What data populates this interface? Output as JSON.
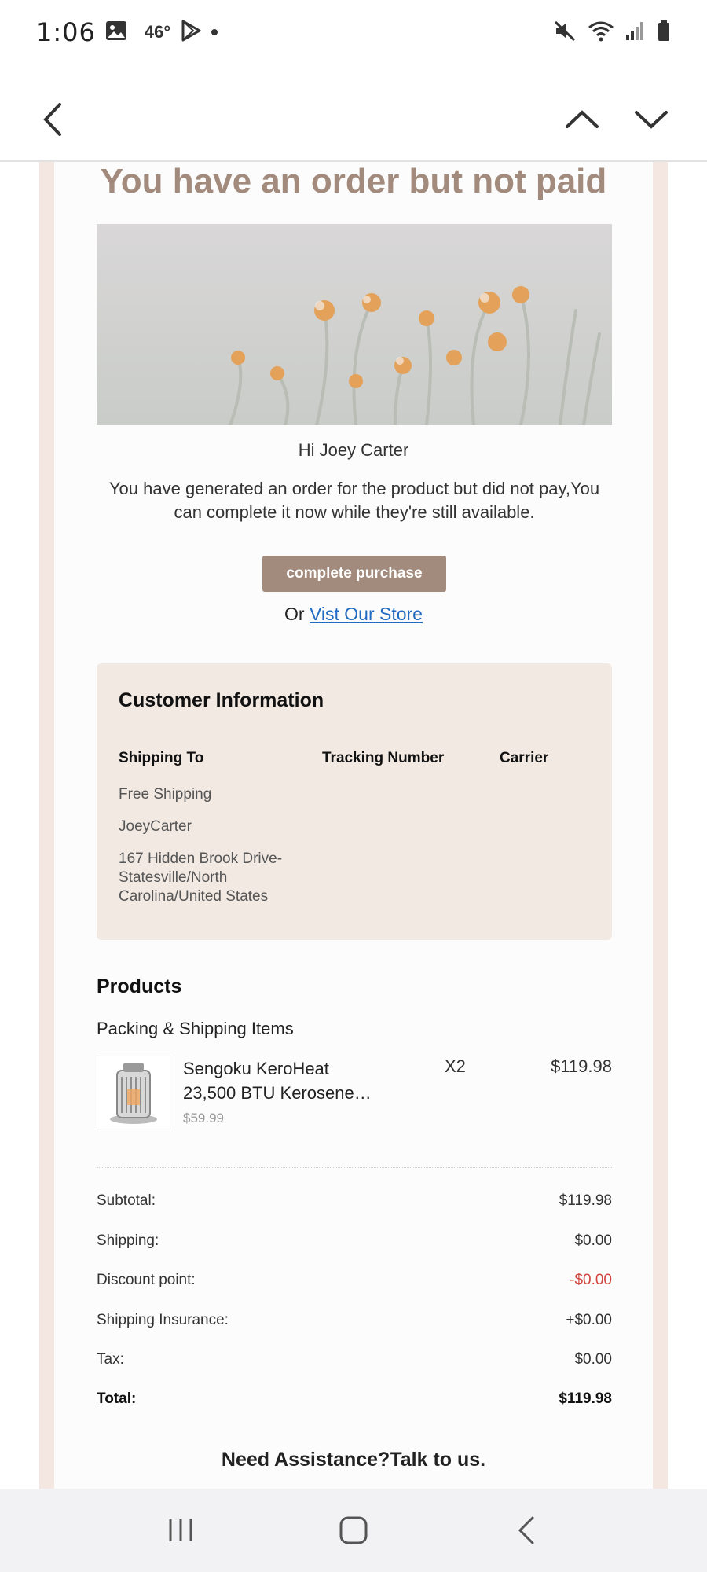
{
  "status_bar": {
    "time": "1:06",
    "temperature": "46°",
    "icons": [
      "image-icon",
      "play-store-icon",
      "mute-icon",
      "wifi-icon",
      "signal-icon",
      "battery-icon"
    ]
  },
  "toolbar": {
    "icons": [
      "back-arrow-icon",
      "chevron-up-icon",
      "chevron-down-icon"
    ]
  },
  "email": {
    "headline": "You have an order but not paid",
    "greeting": "Hi Joey Carter",
    "intro": "You have generated an order for the product but did not pay,You can complete it now while they're still available.",
    "cta_label": "complete purchase",
    "or_text": "Or ",
    "store_link": "Vist Our Store",
    "customer_info": {
      "title": "Customer Information",
      "col_shipping": "Shipping To",
      "col_tracking": "Tracking Number",
      "col_carrier": "Carrier",
      "shipping_method": "Free Shipping",
      "name": "JoeyCarter",
      "address": "167 Hidden Brook Drive-Statesville/North Carolina/United States"
    },
    "products": {
      "title": "Products",
      "subtitle": "Packing & Shipping Items",
      "items": [
        {
          "name": "Sengoku KeroHeat 23,500 BTU Kerosene…",
          "unit_price": "$59.99",
          "quantity": "X2",
          "line_total": "$119.98"
        }
      ]
    },
    "summary": {
      "subtotal_label": "Subtotal:",
      "subtotal": "$119.98",
      "shipping_label": "Shipping:",
      "shipping": "$0.00",
      "discount_label": "Discount point:",
      "discount": "-$0.00",
      "insurance_label": "Shipping Insurance:",
      "insurance": "+$0.00",
      "tax_label": "Tax:",
      "tax": "$0.00",
      "total_label": "Total:",
      "total": "$119.98"
    },
    "assistance": "Need Assistance?Talk to us."
  },
  "colors": {
    "accent": "#a28b7c",
    "frame": "#f4e7e1",
    "info_box": "#f2e9e3",
    "link": "#1f6bc1",
    "negative": "#d0453f"
  },
  "navbar": {
    "icons": [
      "recent-apps-icon",
      "home-icon",
      "back-icon"
    ]
  }
}
